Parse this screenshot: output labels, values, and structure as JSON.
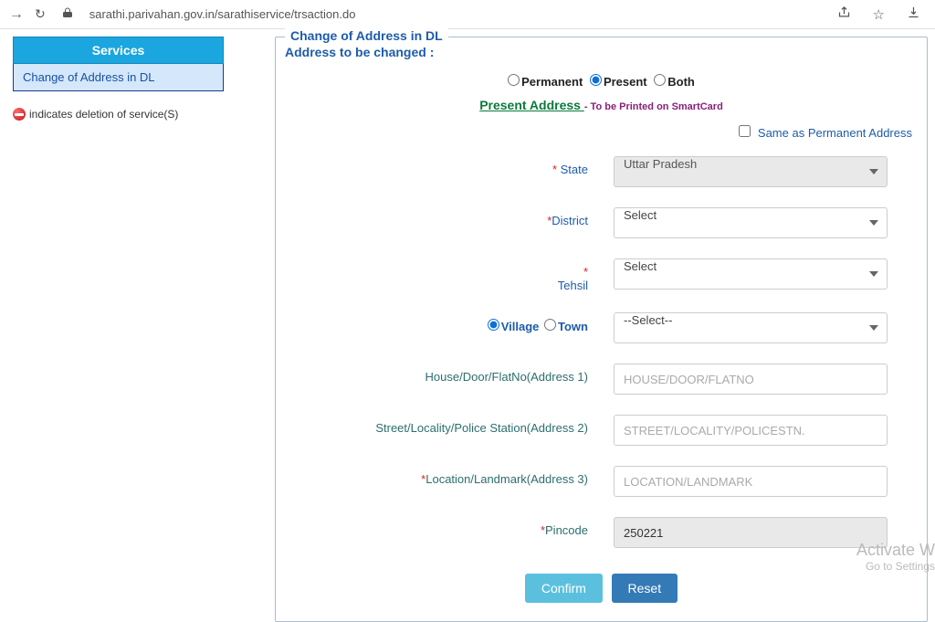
{
  "browser": {
    "url": "sarathi.parivahan.gov.in/sarathiservice/trsaction.do"
  },
  "sidebar": {
    "header": "Services",
    "items": [
      "Change of Address in DL"
    ],
    "deletion_note": "indicates deletion of service(S)"
  },
  "form": {
    "legend": "Change of Address in DL",
    "section_label": "Address to be changed :",
    "address_type": {
      "options": {
        "permanent": "Permanent",
        "present": "Present",
        "both": "Both"
      },
      "selected": "present"
    },
    "present_address_label": "Present Address ",
    "smartcard_note": "- To be Printed on SmartCard",
    "same_as_label": "Same as Permanent Address",
    "labels": {
      "state": "State",
      "district": "District",
      "tehsil": "Tehsil",
      "village": "Village",
      "town": "Town",
      "addr1": "House/Door/FlatNo(Address 1)",
      "addr2": "Street/Locality/Police Station(Address 2)",
      "addr3": "Location/Landmark(Address 3)",
      "pincode": "Pincode"
    },
    "values": {
      "state": "Uttar Pradesh",
      "district": "Select",
      "tehsil": "Select",
      "village_or_town_select": "--Select--",
      "vt_selected": "village",
      "addr1": "",
      "addr2": "",
      "addr3": "",
      "pincode": "250221"
    },
    "placeholders": {
      "addr1": "HOUSE/DOOR/FLATNO",
      "addr2": "STREET/LOCALITY/POLICESTN.",
      "addr3": "LOCATION/LANDMARK"
    },
    "buttons": {
      "confirm": "Confirm",
      "reset": "Reset"
    }
  },
  "watermark": {
    "line1": "Activate W",
    "line2": "Go to Settings"
  },
  "req": "*"
}
